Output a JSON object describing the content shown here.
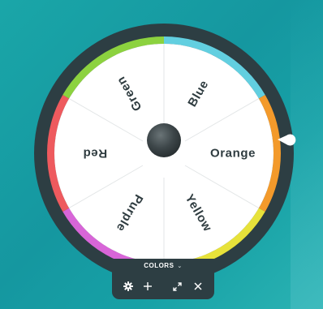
{
  "wheel": {
    "segments": [
      {
        "label": "Blue",
        "rim_color": "#62cfe0"
      },
      {
        "label": "Orange",
        "rim_color": "#f39a2b"
      },
      {
        "label": "Yellow",
        "rim_color": "#e7e23a"
      },
      {
        "label": "Purple",
        "rim_color": "#d865d8"
      },
      {
        "label": "Red",
        "rim_color": "#ee5a5e"
      },
      {
        "label": "Green",
        "rim_color": "#8cd23f"
      }
    ],
    "selected": "Orange",
    "face_color": "#ffffff",
    "frame_color": "#2d3e43",
    "hub_color": "#3b4548",
    "pointer_color": "#ffffff"
  },
  "toolbar": {
    "list_title": "COLORS",
    "dropdown_icon": "chevron-down-icon",
    "buttons": [
      {
        "name": "settings-button",
        "icon": "gear-icon"
      },
      {
        "name": "add-button",
        "icon": "plus-icon"
      },
      {
        "name": "expand-button",
        "icon": "expand-icon"
      },
      {
        "name": "close-button",
        "icon": "close-icon"
      }
    ]
  },
  "background": {
    "color": "#1aa6a8"
  }
}
